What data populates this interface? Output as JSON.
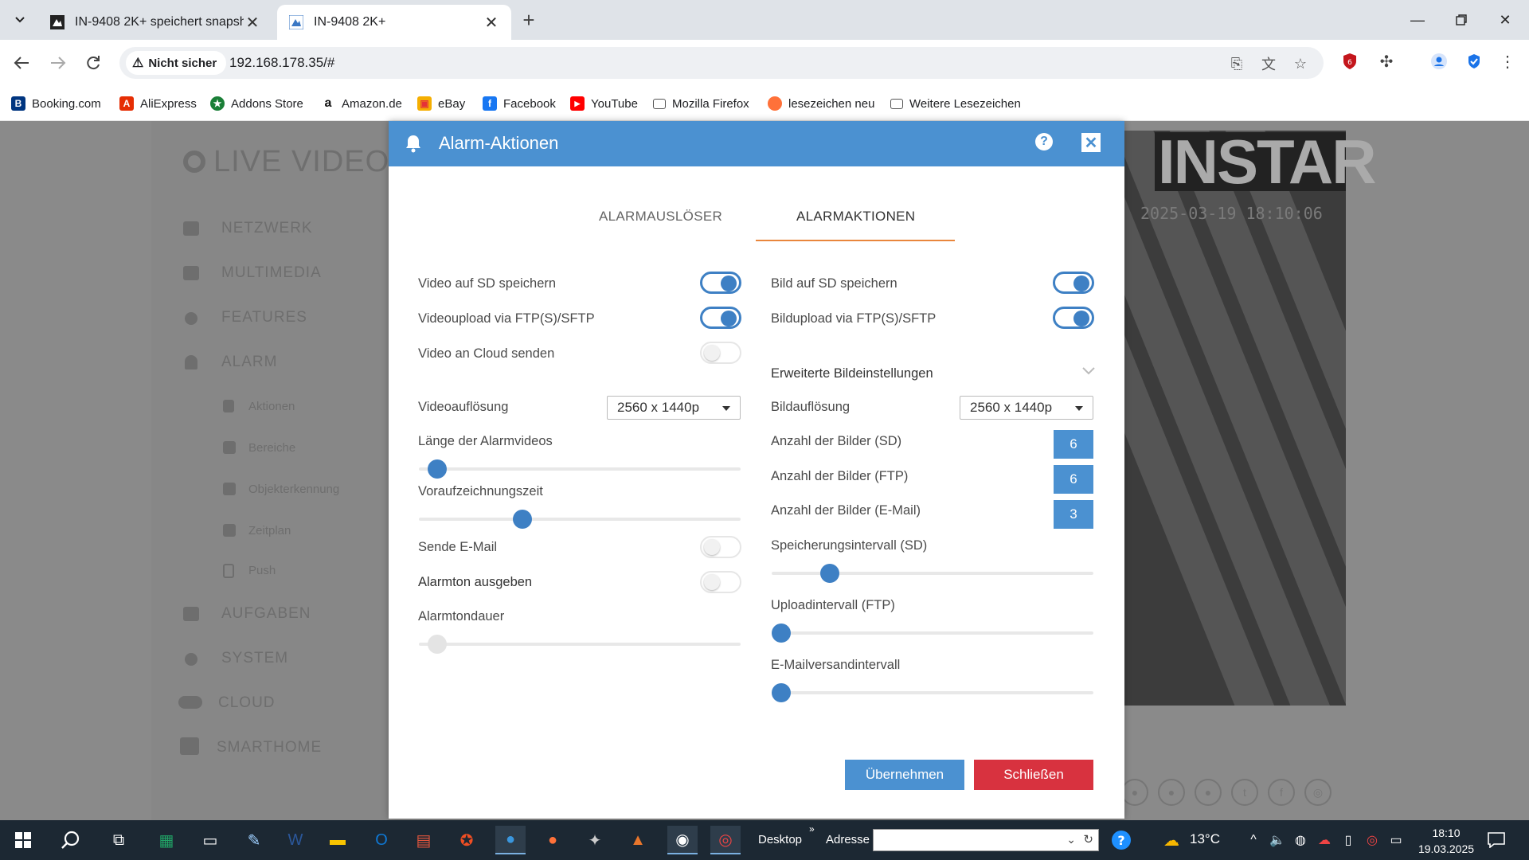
{
  "browser": {
    "tabs": [
      {
        "title": "IN-9408 2K+ speichert snapsho",
        "active": false
      },
      {
        "title": "IN-9408 2K+",
        "active": true
      }
    ],
    "security_label": "Nicht sicher",
    "url": "192.168.178.35/#",
    "bookmarks": [
      {
        "label": "Booking.com",
        "icon": "booking-icon",
        "color": "#003580"
      },
      {
        "label": "AliExpress",
        "icon": "aliexpress-icon",
        "color": "#e62e04"
      },
      {
        "label": "Addons Store",
        "icon": "addons-icon",
        "color": "#1a7f37"
      },
      {
        "label": "Amazon.de",
        "icon": "amazon-icon",
        "color": "#111111"
      },
      {
        "label": "eBay",
        "icon": "ebay-icon",
        "color": "#e53238"
      },
      {
        "label": "Facebook",
        "icon": "facebook-icon",
        "color": "#1877f2"
      },
      {
        "label": "YouTube",
        "icon": "youtube-icon",
        "color": "#ff0000"
      },
      {
        "label": "Mozilla Firefox",
        "icon": "folder-icon",
        "color": "#555555"
      },
      {
        "label": "lesezeichen neu",
        "icon": "firefox-icon",
        "color": "#ff7139"
      },
      {
        "label": "Weitere Lesezeichen",
        "icon": "folder-icon",
        "color": "#555555"
      }
    ]
  },
  "background": {
    "title": "LIVE VIDEO",
    "nav": [
      "NETZWERK",
      "MULTIMEDIA",
      "FEATURES",
      "ALARM",
      "AUFGABEN",
      "SYSTEM",
      "CLOUD",
      "SMARTHOME"
    ],
    "alarm_sub": [
      "Aktionen",
      "Bereiche",
      "Objekterkennung",
      "Zeitplan",
      "Push"
    ],
    "brand": "INSTAR",
    "camera_timestamp": "2025-03-19 18:10:06"
  },
  "modal": {
    "title": "Alarm-Aktionen",
    "tabs": [
      "ALARMAUSLÖSER",
      "ALARMAKTIONEN"
    ],
    "active_tab": "ALARMAKTIONEN",
    "left": {
      "video_sd": {
        "label": "Video auf SD speichern",
        "on": true
      },
      "video_ftp": {
        "label": "Videoupload via FTP(S)/SFTP",
        "on": true
      },
      "video_cloud": {
        "label": "Video an Cloud senden",
        "on": false
      },
      "resolution": {
        "label": "Videoauflösung",
        "value": "2560 x 1440p"
      },
      "length": {
        "label": "Länge der Alarmvideos",
        "level": 0.03
      },
      "prerecord": {
        "label": "Voraufzeichnungszeit",
        "level": 0.31
      },
      "email": {
        "label": "Sende E-Mail",
        "on": false
      },
      "alarmtone": {
        "label": "Alarmton ausgeben",
        "on": false
      },
      "tone_duration": {
        "label": "Alarmtondauer",
        "level": 0.03
      }
    },
    "right": {
      "image_sd": {
        "label": "Bild auf SD speichern",
        "on": true
      },
      "image_ftp": {
        "label": "Bildupload via FTP(S)/SFTP",
        "on": true
      },
      "advanced": {
        "label": "Erweiterte Bildeinstellungen"
      },
      "resolution": {
        "label": "Bildauflösung",
        "value": "2560 x 1440p"
      },
      "count_sd": {
        "label": "Anzahl der Bilder (SD)",
        "value": "6"
      },
      "count_ftp": {
        "label": "Anzahl der Bilder (FTP)",
        "value": "6"
      },
      "count_email": {
        "label": "Anzahl der Bilder (E-Mail)",
        "value": "3"
      },
      "interval_sd": {
        "label": "Speicherungsintervall (SD)",
        "level": 0.16
      },
      "interval_ftp": {
        "label": "Uploadintervall (FTP)",
        "level": 0.0
      },
      "interval_email": {
        "label": "E-Mailversandintervall",
        "level": 0.0
      }
    },
    "buttons": {
      "apply": "Übernehmen",
      "close": "Schließen"
    }
  },
  "taskbar": {
    "desktop_label": "Desktop",
    "address_label": "Adresse",
    "weather": "13°C",
    "time": "18:10",
    "date": "19.03.2025"
  }
}
